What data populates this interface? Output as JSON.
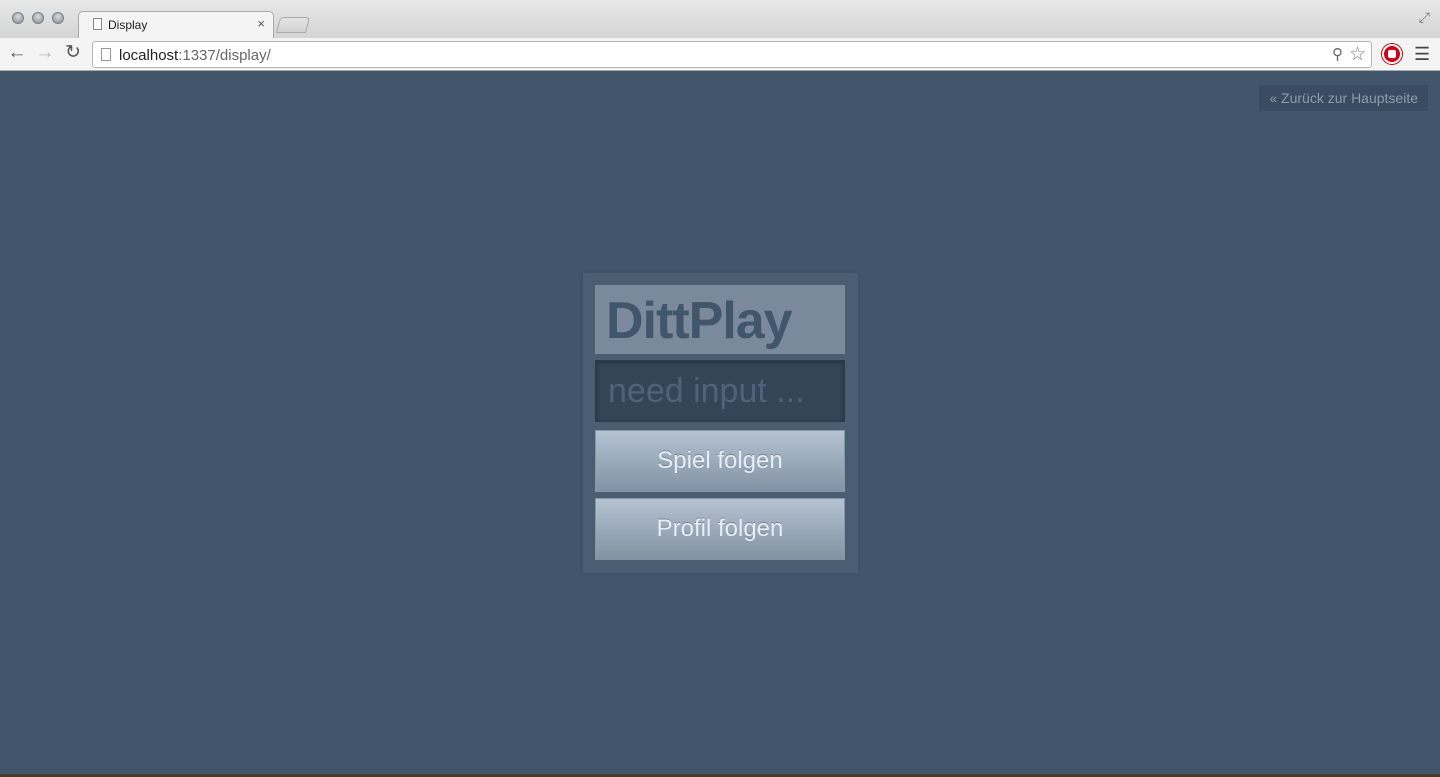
{
  "browser": {
    "tab_title": "Display",
    "tab_close": "×",
    "url_host": "localhost",
    "url_rest": ":1337/display/",
    "icons": [
      "back-icon",
      "forward-icon",
      "reload-icon",
      "zoom-icon",
      "star-icon",
      "extension-icon",
      "menu-icon",
      "fullscreen-icon"
    ]
  },
  "page": {
    "back_link": "« Zurück zur Hauptseite",
    "logo": "DittPlay",
    "input_placeholder": "need input ...",
    "input_value": "",
    "follow_game_button": "Spiel folgen",
    "follow_profile_button": "Profil folgen",
    "colors": {
      "background": "#42566b",
      "panel": "#4a5d71",
      "logo_bg": "#7a8a9c",
      "input_bg": "#344558"
    }
  }
}
